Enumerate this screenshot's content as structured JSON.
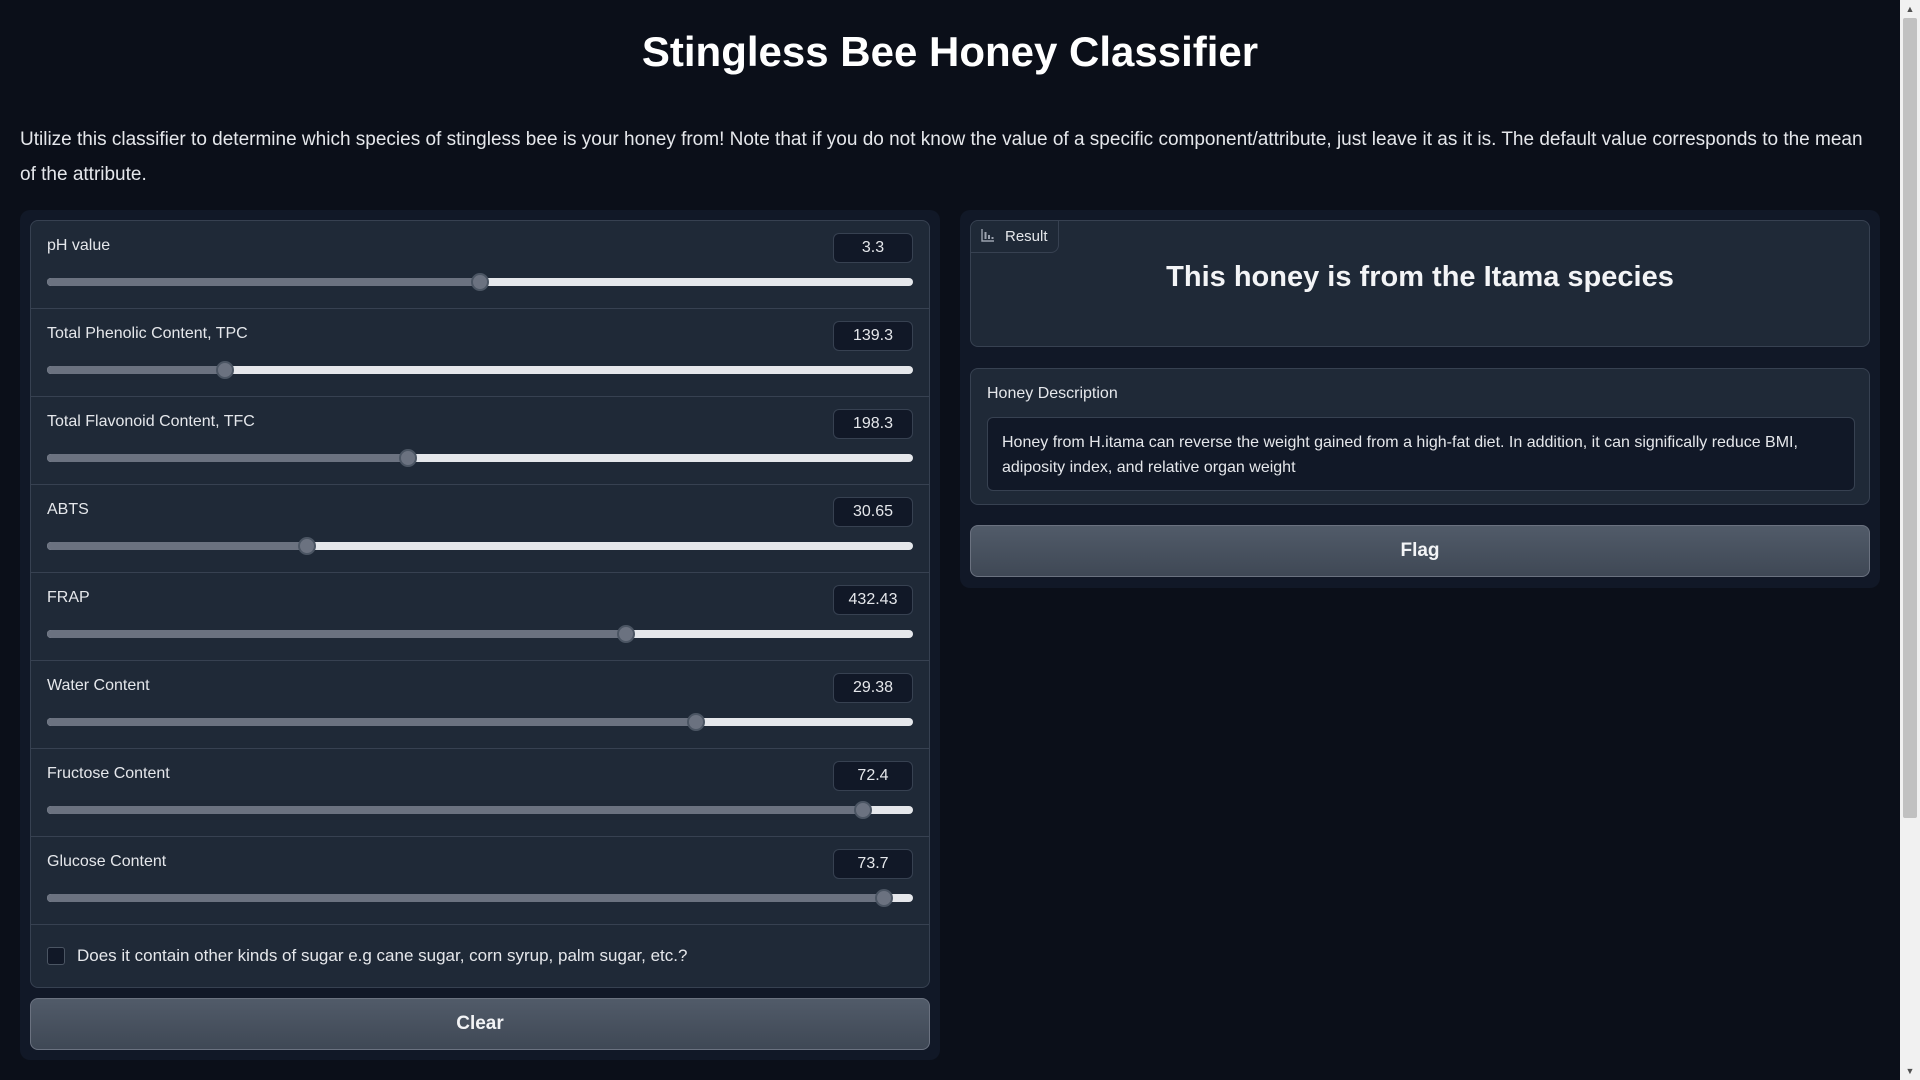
{
  "app": {
    "title": "Stingless Bee Honey Classifier",
    "description": "Utilize this classifier to determine which species of stingless bee is your honey from! Note that if you do not know the value of a specific component/attribute, just leave it as it is. The default value corresponds to the mean of the attribute."
  },
  "inputs": {
    "sliders": [
      {
        "label": "pH value",
        "value": "3.3",
        "fill_fraction": 0.5
      },
      {
        "label": "Total Phenolic Content, TPC",
        "value": "139.3",
        "fill_fraction": 0.205
      },
      {
        "label": "Total Flavonoid Content, TFC",
        "value": "198.3",
        "fill_fraction": 0.417
      },
      {
        "label": "ABTS",
        "value": "30.65",
        "fill_fraction": 0.3
      },
      {
        "label": "FRAP",
        "value": "432.43",
        "fill_fraction": 0.669
      },
      {
        "label": "Water Content",
        "value": "29.38",
        "fill_fraction": 0.749
      },
      {
        "label": "Fructose Content",
        "value": "72.4",
        "fill_fraction": 0.942
      },
      {
        "label": "Glucose Content",
        "value": "73.7",
        "fill_fraction": 0.967
      }
    ],
    "other_sugar_checkbox": {
      "label": "Does it contain other kinds of sugar e.g cane sugar, corn syrup, palm sugar, etc.?",
      "checked": false
    },
    "clear_label": "Clear"
  },
  "output": {
    "result_tag": "Result",
    "result_icon": "bar-chart-icon",
    "result_text": "This honey is from the Itama species",
    "description_label": "Honey Description",
    "description_text": "Honey from H.itama can reverse the weight gained from a high-fat diet. In addition, it can significally reduce BMI, adiposity index, and relative organ weight",
    "flag_label": "Flag"
  },
  "colors": {
    "background": "#0b0f19",
    "panel": "#111827",
    "block": "#1f2937",
    "button": "#4b5563"
  }
}
